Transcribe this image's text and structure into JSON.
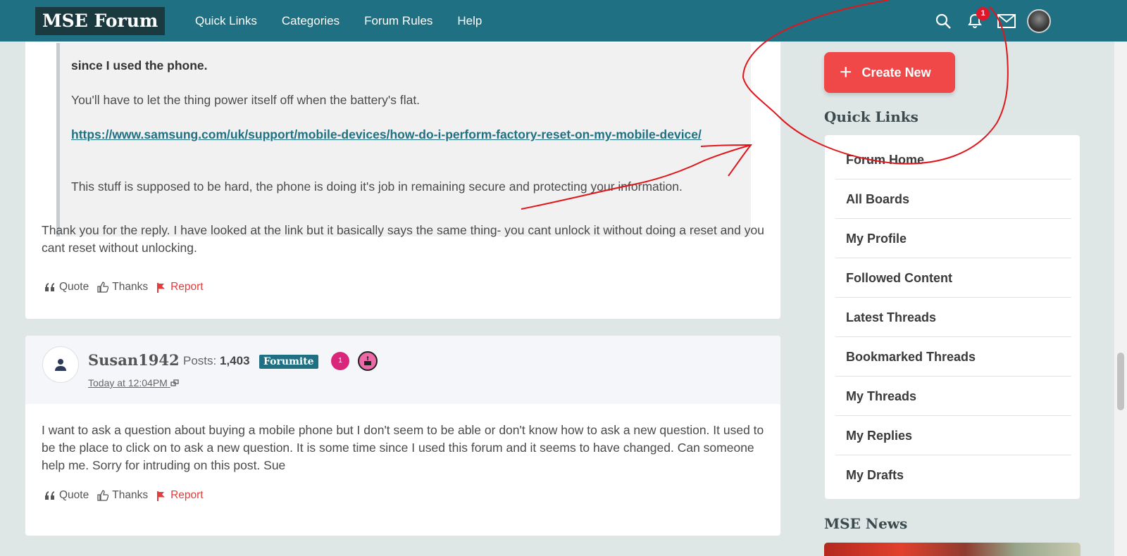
{
  "nav": {
    "logo": "MSE Forum",
    "links": [
      "Quick Links",
      "Categories",
      "Forum Rules",
      "Help"
    ],
    "notification_count": "1"
  },
  "post1": {
    "quote": {
      "bold_line": "since I used the phone.",
      "line1": "You'll have to let the thing power itself off when the battery's flat.",
      "link": "https://www.samsung.com/uk/support/mobile-devices/how-do-i-perform-factory-reset-on-my-mobile-device/",
      "line2": "This stuff is supposed to be hard, the phone is doing it's job in remaining secure and protecting your information."
    },
    "body": "Thank you for the reply. I have looked at the link but it basically says the same thing- you cant unlock it without doing a reset and you cant reset without unlocking.",
    "actions": {
      "quote": "Quote",
      "thanks": "Thanks",
      "report": "Report"
    }
  },
  "post2": {
    "username": "Susan1942",
    "posts_label": "Posts:",
    "posts_count": "1,403",
    "rank": "Forumite",
    "level": "1",
    "timestamp": "Today at 12:04PM",
    "body": "I want to ask a question about buying a mobile phone but I don't seem to be able or don't know how to ask a new question.  It used to be the place to click on to ask a new question.  It is some time since I used this forum and it seems to have changed.  Can someone help me.  Sorry for intruding on this post. Sue",
    "actions": {
      "quote": "Quote",
      "thanks": "Thanks",
      "report": "Report"
    }
  },
  "sidebar": {
    "create_new": "Create New",
    "quick_links_title": "Quick Links",
    "quick_links": [
      "Forum Home",
      "All Boards",
      "My Profile",
      "Followed Content",
      "Latest Threads",
      "Bookmarked Threads",
      "My Threads",
      "My Replies",
      "My Drafts"
    ],
    "news_title": "MSE News"
  },
  "colors": {
    "teal": "#1f7082",
    "accent_red": "#f04848",
    "annotation_red": "#e0161b"
  }
}
